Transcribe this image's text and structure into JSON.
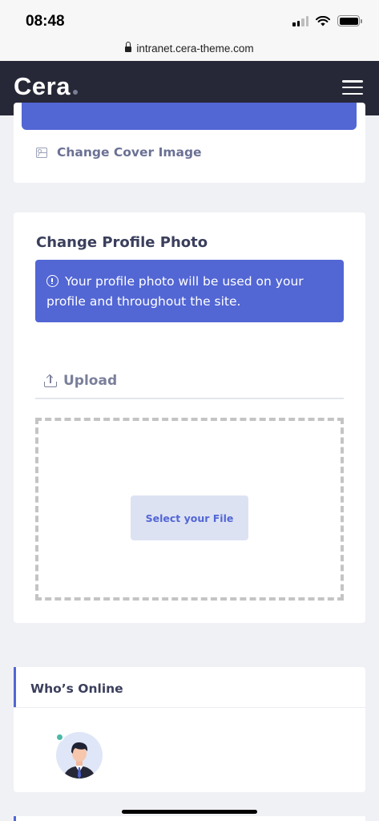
{
  "status_bar": {
    "time": "08:48"
  },
  "browser": {
    "url": "intranet.cera-theme.com"
  },
  "header": {
    "logo": "Cera"
  },
  "cover_card": {
    "link_label": "Change Cover Image"
  },
  "profile_photo": {
    "title": "Change Profile Photo",
    "info_message": "Your profile photo will be used on your profile and throughout the site.",
    "upload_tab_label": "Upload",
    "select_button_label": "Select your File"
  },
  "whos_online": {
    "title": "Who’s Online"
  },
  "colors": {
    "accent": "#5266d4",
    "header_bg": "#262837",
    "page_bg": "#f0f1f5",
    "online_status": "#4bb8a9"
  },
  "icons": {
    "cover": "image-icon",
    "info": "info-circle-icon",
    "upload": "upload-icon",
    "menu": "hamburger-menu-icon"
  }
}
